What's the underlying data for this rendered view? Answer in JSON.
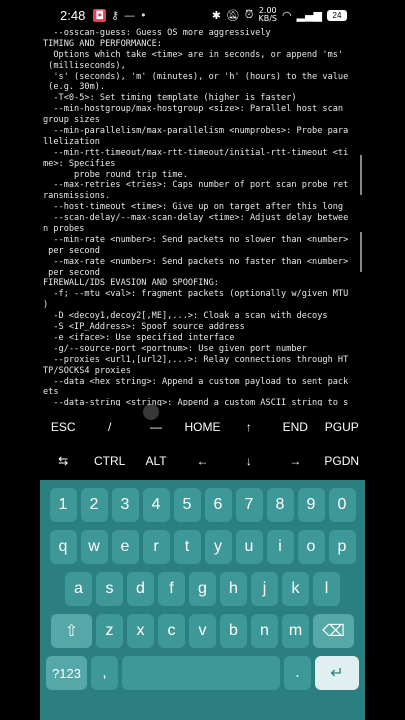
{
  "status_bar": {
    "time": "2:48",
    "net_speed": "2.00",
    "net_unit": "KB/S",
    "battery": "24"
  },
  "terminal": {
    "lines": [
      "  --osscan-guess: Guess OS more aggressively",
      "TIMING AND PERFORMANCE:",
      "  Options which take <time> are in seconds, or append 'ms'",
      " (milliseconds),",
      "  's' (seconds), 'm' (minutes), or 'h' (hours) to the value",
      " (e.g. 30m).",
      "  -T<0-5>: Set timing template (higher is faster)",
      "  --min-hostgroup/max-hostgroup <size>: Parallel host scan",
      "group sizes",
      "  --min-parallelism/max-parallelism <numprobes>: Probe para",
      "llelization",
      "  --min-rtt-timeout/max-rtt-timeout/initial-rtt-timeout <ti",
      "me>: Specifies",
      "      probe round trip time.",
      "  --max-retries <tries>: Caps number of port scan probe ret",
      "ransmissions.",
      "  --host-timeout <time>: Give up on target after this long",
      "  --scan-delay/--max-scan-delay <time>: Adjust delay betwee",
      "n probes",
      "  --min-rate <number>: Send packets no slower than <number>",
      " per second",
      "  --max-rate <number>: Send packets no faster than <number>",
      " per second",
      "FIREWALL/IDS EVASION AND SPOOFING:",
      "  -f; --mtu <val>: fragment packets (optionally w/given MTU",
      ")",
      "  -D <decoy1,decoy2[,ME],...>: Cloak a scan with decoys",
      "  -S <IP_Address>: Spoof source address",
      "  -e <iface>: Use specified interface",
      "  -g/--source-port <portnum>: Use given port number",
      "  --proxies <url1,[url2],...>: Relay connections through HT",
      "TP/SOCKS4 proxies",
      "  --data <hex string>: Append a custom payload to sent pack",
      "ets",
      "  --data-string <string>: Append a custom ASCII string to s"
    ]
  },
  "extra_keys": {
    "row1": [
      "ESC",
      "/",
      "—",
      "HOME",
      "↑",
      "END",
      "PGUP"
    ],
    "row2": [
      "⇆",
      "CTRL",
      "ALT",
      "←",
      "↓",
      "→",
      "PGDN"
    ]
  },
  "keyboard": {
    "numbers": [
      "1",
      "2",
      "3",
      "4",
      "5",
      "6",
      "7",
      "8",
      "9",
      "0"
    ],
    "row1": [
      "q",
      "w",
      "e",
      "r",
      "t",
      "y",
      "u",
      "i",
      "o",
      "p"
    ],
    "row2": [
      "a",
      "s",
      "d",
      "f",
      "g",
      "h",
      "j",
      "k",
      "l"
    ],
    "row3": [
      "z",
      "x",
      "c",
      "v",
      "b",
      "n",
      "m"
    ],
    "bottom": {
      "symbols": "?123",
      "comma": ",",
      "period": "."
    }
  }
}
